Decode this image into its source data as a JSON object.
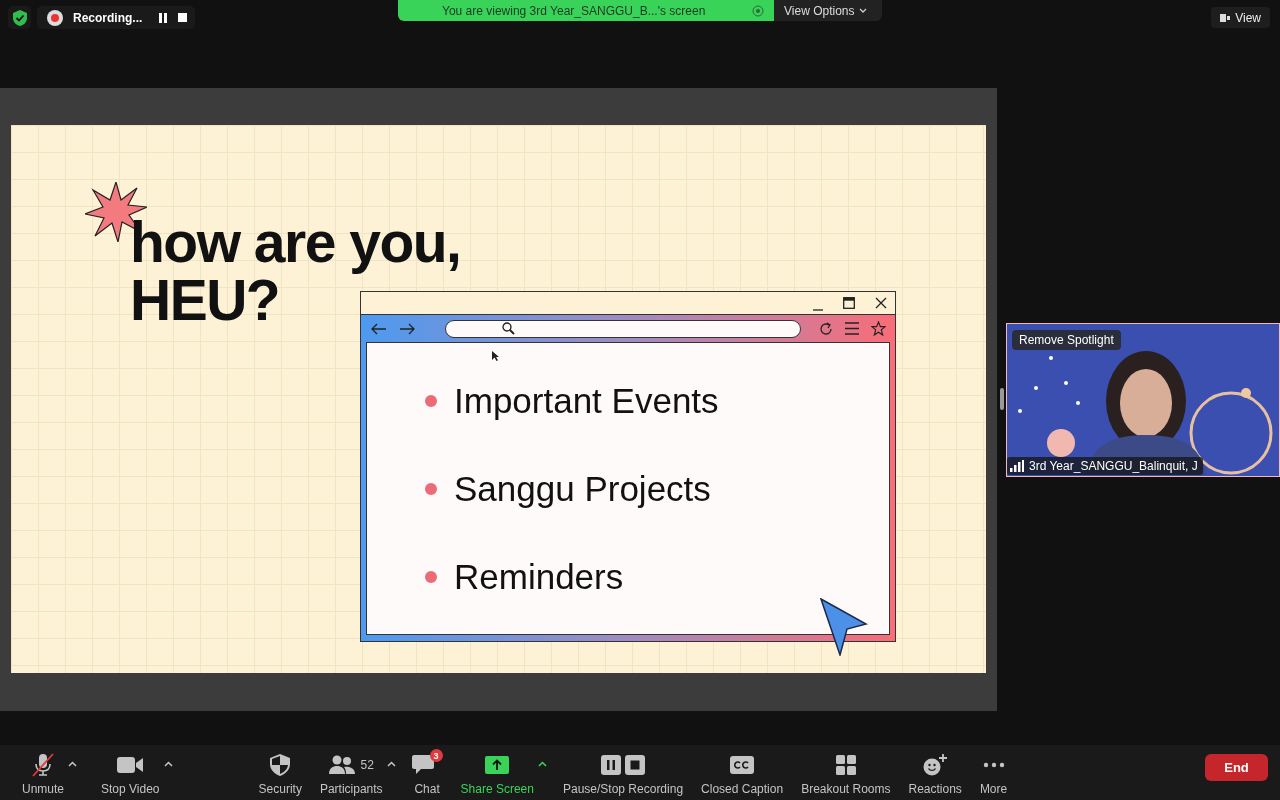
{
  "top_bar": {
    "recording_label": "Recording...",
    "banner_text": "You are viewing 3rd Year_SANGGU_B...'s screen",
    "view_options": "View Options",
    "view_button": "View"
  },
  "slide": {
    "title_lines": [
      "how are you,",
      "HEU?"
    ],
    "bullets": [
      "Important Events",
      "Sanggu Projects",
      "Reminders"
    ]
  },
  "video_tile": {
    "kind": "picture",
    "spotlight_button": "Remove Spotlight",
    "participant_name": "3rd Year_SANGGU_Balinquit, J"
  },
  "toolbar": {
    "left_items": [
      {
        "kind": "mic",
        "label": "Unmute",
        "muted": true,
        "caret": true,
        "highlighted": false
      },
      {
        "kind": "video",
        "label": "Stop Video",
        "muted": false,
        "caret": true,
        "highlighted": false
      }
    ],
    "center_items": [
      {
        "kind": "security",
        "label": "Security",
        "caret": false,
        "highlighted": false
      },
      {
        "kind": "participants",
        "label": "Participants",
        "count": "52",
        "caret": true,
        "highlighted": false
      },
      {
        "kind": "chat",
        "label": "Chat",
        "badge": "3",
        "caret": false,
        "highlighted": false
      },
      {
        "kind": "share",
        "label": "Share Screen",
        "caret": true,
        "highlighted": true
      },
      {
        "kind": "recording",
        "label": "Pause/Stop Recording",
        "caret": false,
        "highlighted": false
      },
      {
        "kind": "cc",
        "label": "Closed Caption",
        "caret": false,
        "highlighted": false
      },
      {
        "kind": "breakout",
        "label": "Breakout Rooms",
        "caret": false,
        "highlighted": false
      },
      {
        "kind": "reactions",
        "label": "Reactions",
        "caret": false,
        "highlighted": false
      },
      {
        "kind": "more",
        "label": "More",
        "caret": false,
        "highlighted": false
      }
    ],
    "end_button": "End"
  }
}
